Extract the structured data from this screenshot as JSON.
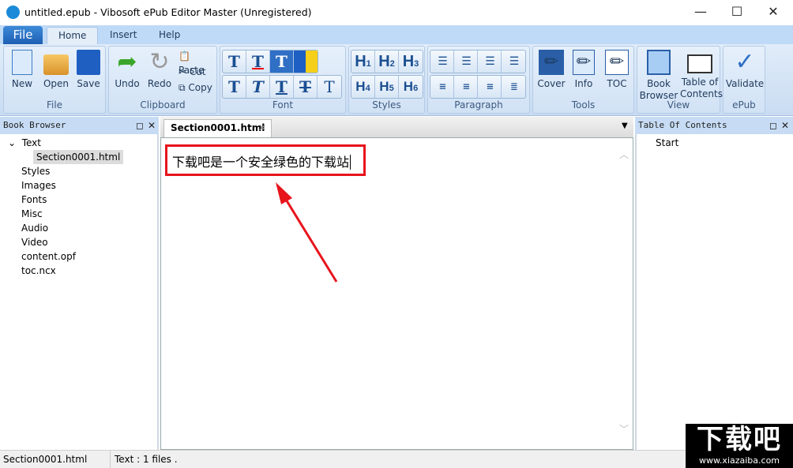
{
  "window": {
    "title": "untitled.epub - Vibosoft ePub Editor Master (Unregistered)",
    "minimize": "—",
    "maximize": "☐",
    "close": "✕"
  },
  "menu_tabs": {
    "file": "File",
    "home": "Home",
    "insert": "Insert",
    "help": "Help"
  },
  "ribbon": {
    "file": {
      "label": "File",
      "new": "New",
      "open": "Open",
      "save": "Save"
    },
    "clipboard": {
      "label": "Clipboard",
      "undo": "Undo",
      "redo": "Redo",
      "paste": "Paste",
      "cut": "Cut",
      "copy": "Copy"
    },
    "font": {
      "label": "Font"
    },
    "styles": {
      "label": "Styles",
      "h": [
        "H",
        "H",
        "H",
        "H",
        "H",
        "H"
      ],
      "n": [
        "1",
        "2",
        "3",
        "4",
        "5",
        "6"
      ]
    },
    "paragraph": {
      "label": "Paragraph"
    },
    "tools": {
      "label": "Tools",
      "cover": "Cover",
      "info": "Info",
      "toc": "TOC"
    },
    "view": {
      "label": "View",
      "book_browser_1": "Book",
      "book_browser_2": "Browser",
      "toc_1": "Table of",
      "toc_2": "Contents"
    },
    "epub": {
      "label": "ePub",
      "validate": "Validate"
    }
  },
  "book_browser": {
    "title": "Book Browser",
    "items": [
      "Text",
      "Section0001.html",
      "Styles",
      "Images",
      "Fonts",
      "Misc",
      "Audio",
      "Video",
      "content.opf",
      "toc.ncx"
    ]
  },
  "editor": {
    "tab": "Section0001.html",
    "content": "下载吧是一个安全绿色的下载站"
  },
  "toc_panel": {
    "title": "Table Of Contents",
    "items": [
      "Start"
    ]
  },
  "status": {
    "file": "Section0001.html",
    "info": "Text : 1 files ."
  },
  "watermark": {
    "text": "下载吧",
    "url": "www.xiazaiba.com"
  },
  "colors": {
    "accent": "#1e5fb4",
    "annotation": "#e8141c"
  }
}
